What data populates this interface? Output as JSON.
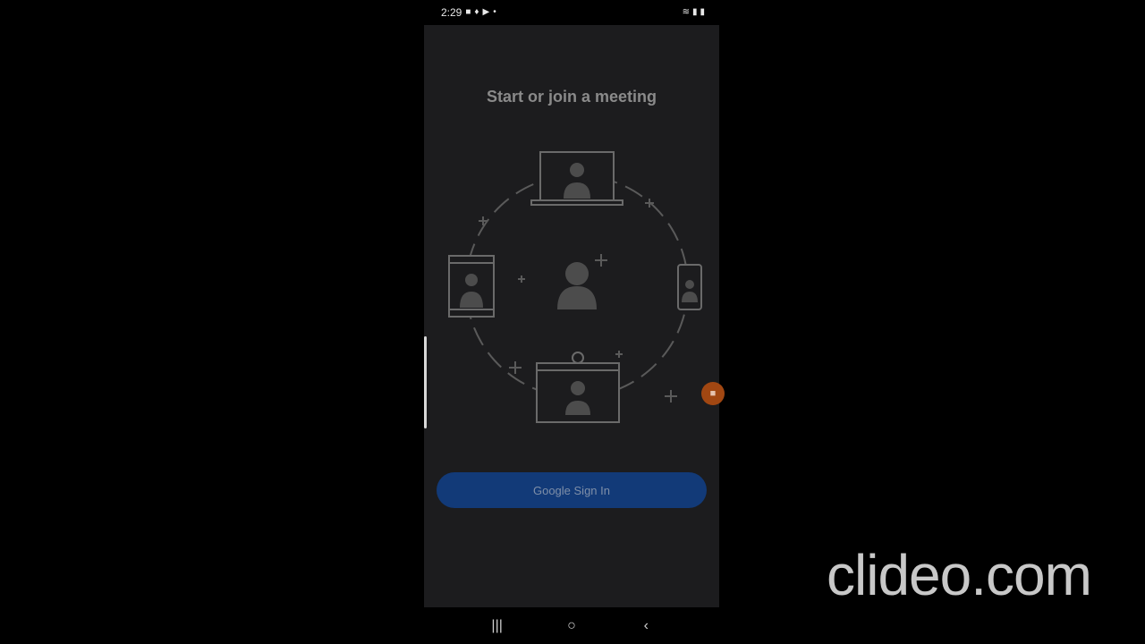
{
  "status_bar": {
    "time": "2:29",
    "left_icons": [
      "video-camera-icon",
      "twitter-icon",
      "youtube-icon",
      "dot-icon"
    ],
    "right_icons": [
      "wifi-icon",
      "signal-icon",
      "battery-icon"
    ]
  },
  "main": {
    "heading": "Start or join a meeting",
    "signin_button": "Google Sign In"
  },
  "navigation": {
    "recents": "|||",
    "home": "○",
    "back": "‹"
  },
  "watermark": "clideo.com",
  "colors": {
    "screen_bg": "#1c1c1e",
    "button_bg": "#123a78",
    "heading": "#8a8a8a",
    "recorder": "#a14712"
  }
}
